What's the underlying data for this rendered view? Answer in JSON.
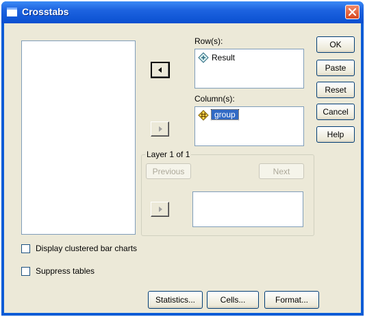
{
  "window": {
    "title": "Crosstabs"
  },
  "rows": {
    "label": "Row(s):",
    "items": [
      {
        "name": "Result",
        "icon": "scale-variable-icon"
      }
    ]
  },
  "columns": {
    "label": "Column(s):",
    "items": [
      {
        "name": "group",
        "icon": "nominal-variable-icon",
        "selected": true
      }
    ]
  },
  "layer": {
    "label": "Layer 1 of 1",
    "previous": "Previous",
    "next": "Next"
  },
  "buttons": {
    "ok": "OK",
    "paste": "Paste",
    "reset": "Reset",
    "cancel": "Cancel",
    "help": "Help"
  },
  "options": {
    "clustered": {
      "label": "Display clustered bar charts",
      "checked": false
    },
    "suppress": {
      "label": "Suppress tables",
      "checked": false
    }
  },
  "bottom_buttons": {
    "statistics": "Statistics...",
    "cells": "Cells...",
    "format": "Format..."
  },
  "colors": {
    "titlebar": "#0a4fd0",
    "dialog_bg": "#ece9d8",
    "selection": "#316ac5",
    "close": "#d8471f"
  }
}
